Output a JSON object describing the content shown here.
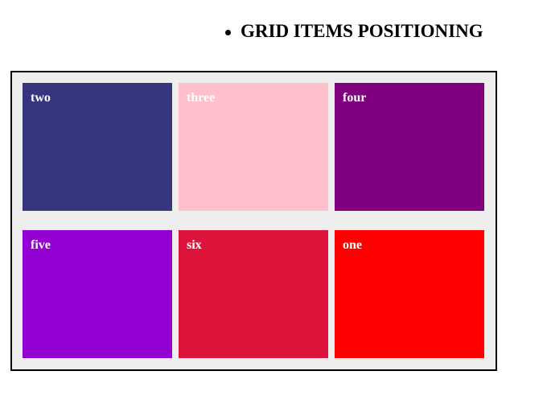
{
  "heading": {
    "text": "GRID ITEMS POSITIONING"
  },
  "grid": {
    "items": [
      {
        "label": "two",
        "color": "#36367f"
      },
      {
        "label": "three",
        "color": "#ffc0cb"
      },
      {
        "label": "four",
        "color": "#800080"
      },
      {
        "label": "five",
        "color": "#9400d3"
      },
      {
        "label": "six",
        "color": "#dc143c"
      },
      {
        "label": "one",
        "color": "#ff0000"
      }
    ]
  }
}
